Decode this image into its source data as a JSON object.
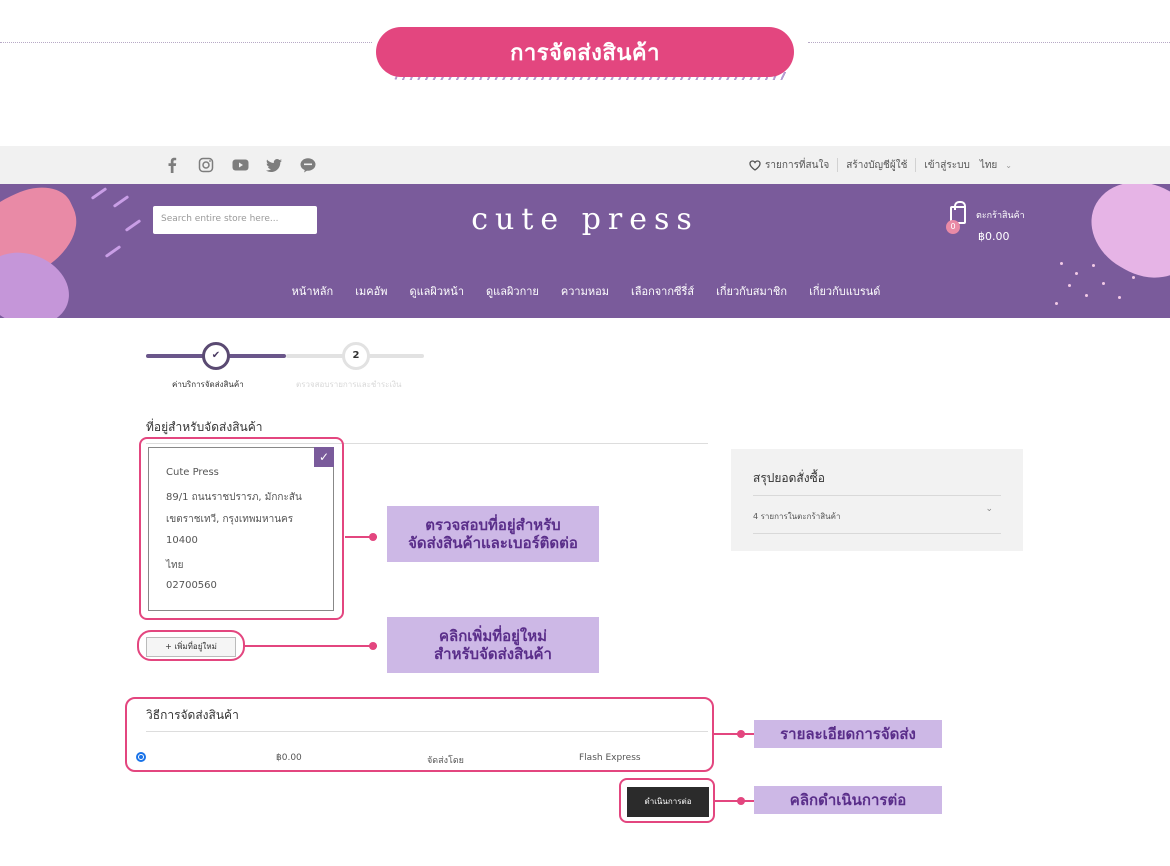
{
  "banner": {
    "title": "การจัดส่งสินค้า"
  },
  "topbar": {
    "social_icons": [
      "facebook-icon",
      "instagram-icon",
      "youtube-icon",
      "twitter-icon",
      "line-icon"
    ],
    "wishlist": "รายการที่สนใจ",
    "create_account": "สร้างบัญชีผู้ใช้",
    "login": "เข้าสู่ระบบ",
    "language": "ไทย"
  },
  "header": {
    "search_placeholder": "Search entire store here...",
    "logo": "cute press",
    "cart_label": "ตะกร้าสินค้า",
    "cart_count": "0",
    "cart_total": "฿0.00",
    "nav": [
      "หน้าหลัก",
      "เมคอัพ",
      "ดูแลผิวหน้า",
      "ดูแลผิวกาย",
      "ความหอม",
      "เลือกจากซีรี่ส์",
      "เกี่ยวกับสมาชิก",
      "เกี่ยวกับแบรนด์"
    ]
  },
  "progress": {
    "step1_label": "ค่าบริการจัดส่งสินค้า",
    "step2_number": "2",
    "step2_label": "ตรวจสอบรายการและชำระเงิน"
  },
  "address": {
    "section_title": "ที่อยู่สำหรับจัดส่งสินค้า",
    "lines": [
      "Cute Press",
      "89/1 ถนนราชปรารภ, มักกะสัน",
      "เขตราชเทวี, กรุงเทพมหานคร",
      "10400",
      "ไทย",
      "02700560"
    ],
    "add_button": "+ เพิ่มที่อยู่ใหม่"
  },
  "summary": {
    "title": "สรุปยอดสั่งซื้อ",
    "items": "4 รายการในตะกร้าสินค้า"
  },
  "shipping": {
    "section_title": "วิธีการจัดส่งสินค้า",
    "price": "฿0.00",
    "by_label": "จัดส่งโดย",
    "carrier": "Flash Express"
  },
  "continue_button": "ดำเนินการต่อ",
  "callouts": {
    "check_address": [
      "ตรวจสอบที่อยู่สำหรับ",
      "จัดส่งสินค้าและเบอร์ติดต่อ"
    ],
    "add_address": [
      "คลิกเพิ่มที่อยู่ใหม่",
      "สำหรับจัดส่งสินค้า"
    ],
    "shipping_detail": "รายละเอียดการจัดส่ง",
    "click_continue": "คลิกดำเนินการต่อ"
  },
  "colors": {
    "accent_pink": "#e3467f",
    "brand_purple": "#7a5b9b",
    "callout_lavender": "#cdb8e6"
  }
}
